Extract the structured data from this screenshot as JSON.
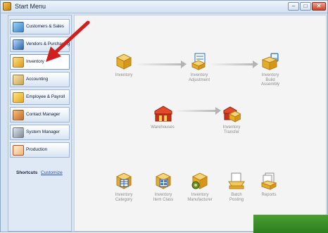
{
  "window": {
    "title": "Start Menu"
  },
  "sidebar": {
    "items": [
      {
        "label": "Customers & Sales",
        "icon": "customers-sales-icon"
      },
      {
        "label": "Vendors & Purchasing",
        "icon": "vendors-purchasing-icon"
      },
      {
        "label": "Inventory",
        "icon": "inventory-box-icon",
        "active": true
      },
      {
        "label": "Accounting",
        "icon": "ledger-icon"
      },
      {
        "label": "Employee & Payroll",
        "icon": "payroll-icon"
      },
      {
        "label": "Contact Manager",
        "icon": "contacts-icon"
      },
      {
        "label": "System Manager",
        "icon": "tools-icon"
      },
      {
        "label": "Production",
        "icon": "production-icon"
      }
    ],
    "shortcuts_label": "Shortcuts",
    "customize_label": "Customize"
  },
  "main": {
    "workflow": {
      "inventory": "Inventory",
      "inventory_adjustment": "Inventory\nAdjustment",
      "inventory_build_assembly": "Inventory\nBuild\nAssembly",
      "warehouses": "Warehouses",
      "inventory_transfer": "Inventory\nTransfer"
    },
    "bottom": {
      "inventory_category": "Inventory\nCategory",
      "inventory_item_class": "Inventory\nItem Class",
      "inventory_manufacturer": "Inventory\nManufacturer",
      "batch_posting": "Batch\nPosting",
      "reports": "Reports"
    }
  },
  "colors": {
    "arrow": "#d11f1f",
    "connector": "#b4b4b4",
    "label": "#8d8d8d"
  }
}
